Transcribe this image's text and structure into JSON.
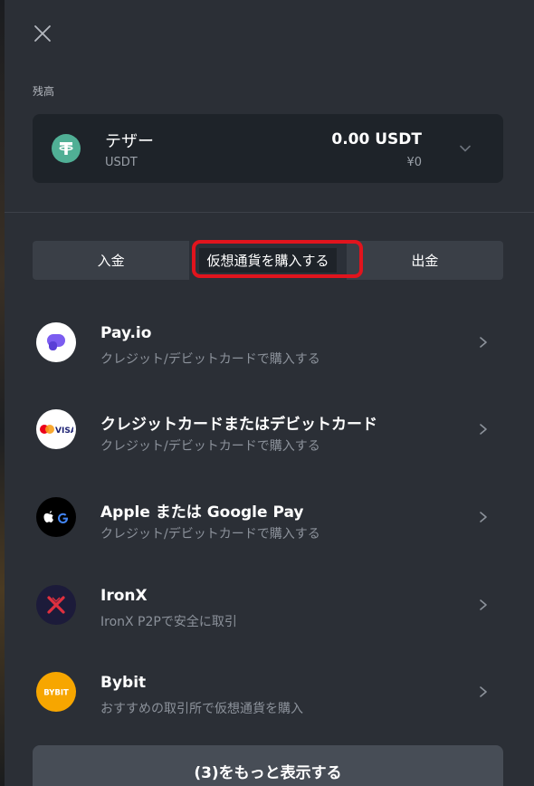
{
  "header": {
    "close_icon": "close-icon"
  },
  "balance": {
    "label": "残高",
    "coin_name": "テザー",
    "coin_symbol": "USDT",
    "amount": "0.00 USDT",
    "fiat": "¥0",
    "logo_icon": "tether-icon",
    "dropdown_icon": "chevron-down-icon"
  },
  "tabs": [
    {
      "label": "入金",
      "active": false
    },
    {
      "label": "仮想通貨を購入する",
      "active": true
    },
    {
      "label": "出金",
      "active": false
    }
  ],
  "providers": [
    {
      "title": "Pay.io",
      "subtitle": "クレジット/デビットカードで購入する",
      "icon": "payio-icon"
    },
    {
      "title": "クレジットカードまたはデビットカード",
      "subtitle": "クレジット/デビットカードで購入する",
      "icon": "mastercard-visa-icon"
    },
    {
      "title": "Apple または Google Pay",
      "subtitle": "クレジット/デビットカードで購入する",
      "icon": "apple-google-pay-icon"
    },
    {
      "title": "IronX",
      "subtitle": "IronX P2Pで安全に取引",
      "icon": "ironx-icon"
    },
    {
      "title": "Bybit",
      "subtitle": "おすすめの取引所で仮想通貨を購入",
      "icon": "bybit-icon",
      "logo_text": "BYBIT"
    }
  ],
  "more_button": {
    "label": "(3)をもっと表示する"
  },
  "colors": {
    "background": "#2b2f36",
    "card": "#1e2329",
    "tether": "#50af95",
    "highlight": "#e1141d",
    "muted_text": "#8c929b"
  }
}
